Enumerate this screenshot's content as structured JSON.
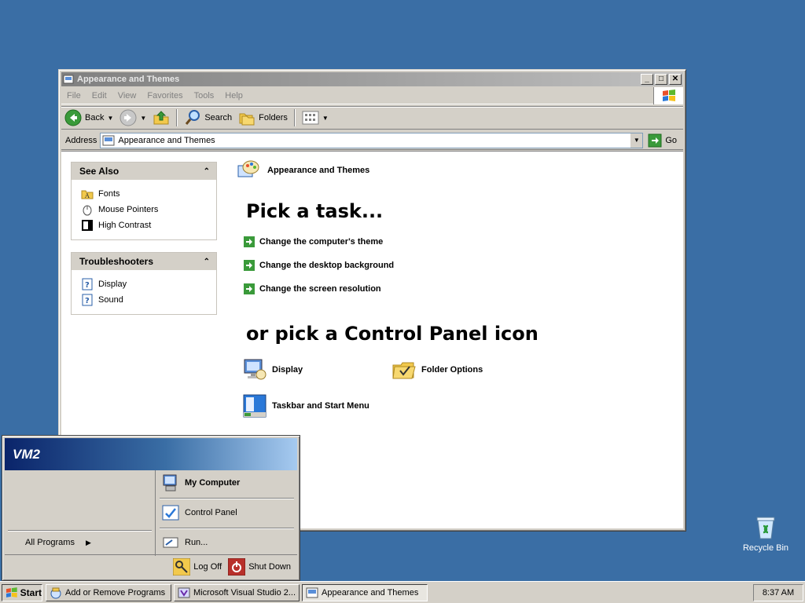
{
  "window": {
    "title": "Appearance and Themes",
    "menu": [
      "File",
      "Edit",
      "View",
      "Favorites",
      "Tools",
      "Help"
    ],
    "toolbar": {
      "back": "Back",
      "search": "Search",
      "folders": "Folders"
    },
    "address": {
      "label": "Address",
      "value": "Appearance and Themes",
      "go": "Go"
    }
  },
  "see_also": {
    "title": "See Also",
    "items": [
      "Fonts",
      "Mouse Pointers",
      "High Contrast"
    ]
  },
  "troubleshooters": {
    "title": "Troubleshooters",
    "items": [
      "Display",
      "Sound"
    ]
  },
  "main": {
    "category": "Appearance and Themes",
    "pick_task": "Pick a task...",
    "tasks": [
      "Change the computer's theme",
      "Change the desktop background",
      "Change the screen resolution"
    ],
    "pick_icon": "or pick a Control Panel icon",
    "icons": [
      "Display",
      "Folder Options",
      "Taskbar and Start Menu"
    ]
  },
  "start_menu": {
    "user": "VM2",
    "all_programs": "All Programs",
    "my_computer": "My Computer",
    "control_panel": "Control Panel",
    "run": "Run...",
    "log_off": "Log Off",
    "shut_down": "Shut Down"
  },
  "desktop": {
    "recycle_bin": "Recycle Bin"
  },
  "taskbar": {
    "start": "Start",
    "items": [
      "Add or Remove Programs",
      "Microsoft Visual Studio 2...",
      "Appearance and Themes"
    ],
    "clock": "8:37 AM"
  }
}
